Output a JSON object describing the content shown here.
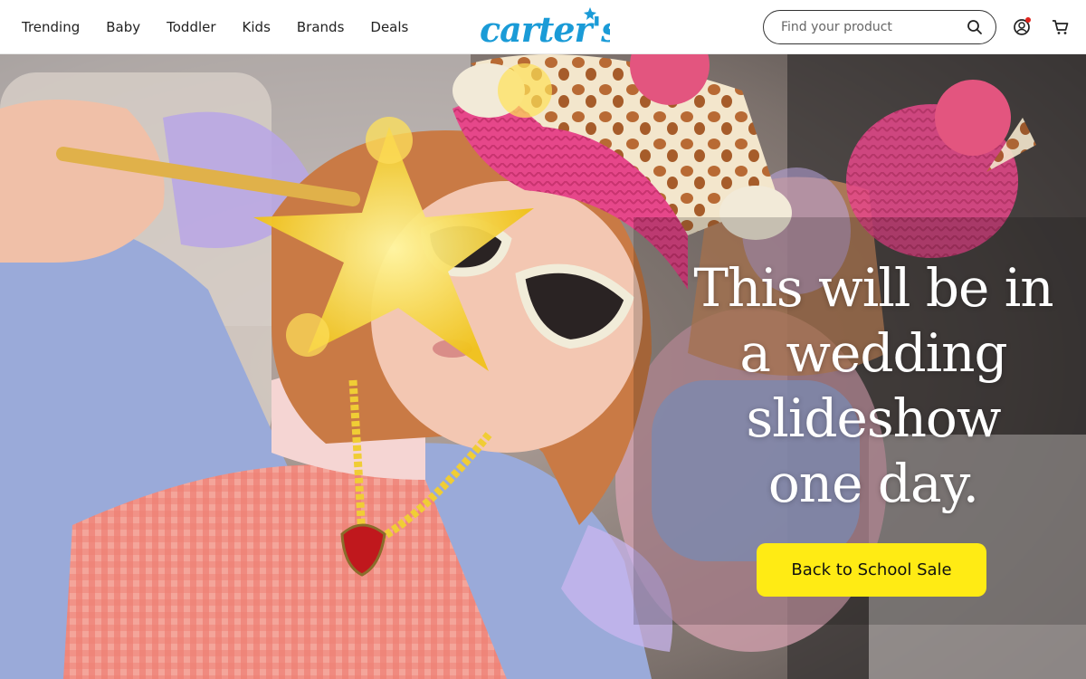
{
  "nav": {
    "items": [
      {
        "label": "Trending"
      },
      {
        "label": "Baby"
      },
      {
        "label": "Toddler"
      },
      {
        "label": "Kids"
      },
      {
        "label": "Brands"
      },
      {
        "label": "Deals"
      }
    ]
  },
  "brand": {
    "logo_text": "carter's",
    "logo_color": "#1a9bd7"
  },
  "search": {
    "placeholder": "Find your product",
    "icon": "search-icon"
  },
  "header_icons": {
    "account": "account-icon",
    "account_badge_color": "#e0241d",
    "cart": "cart-icon"
  },
  "hero": {
    "headline_lines": [
      "This will be in",
      "a wedding",
      "slideshow",
      "one day."
    ],
    "cta_label": "Back to School Sale",
    "cta_color": "#ffeb14",
    "image_description_icon": "hero-photo"
  }
}
